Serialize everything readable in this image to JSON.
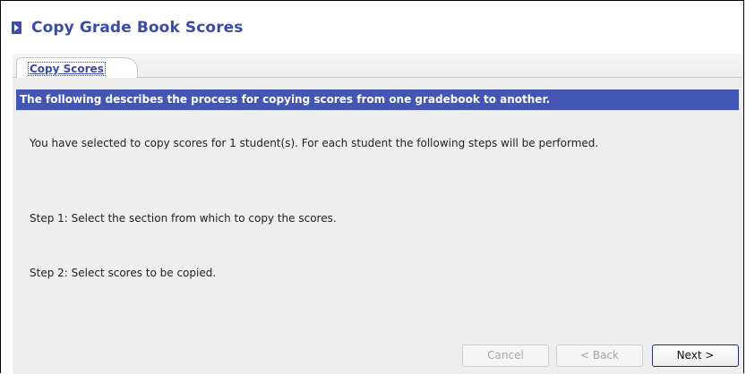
{
  "page": {
    "title": "Copy Grade Book Scores",
    "title_icon": "right-arrow-box-icon"
  },
  "tabs": [
    {
      "label": "Copy Scores",
      "selected": true
    }
  ],
  "content": {
    "header": "The following describes the process for copying scores from one gradebook to another.",
    "intro": "You have selected to copy scores for 1 student(s). For each student the following steps will be performed.",
    "step1": "Step 1: Select the section from which to copy the scores.",
    "step2": "Step 2: Select scores to be copied."
  },
  "buttons": {
    "cancel": {
      "label": "Cancel",
      "enabled": false
    },
    "back": {
      "label": "< Back",
      "enabled": false
    },
    "next": {
      "label": "Next >",
      "enabled": true
    }
  },
  "colors": {
    "title": "#3a4ba5",
    "header_bar": "#4356b3",
    "panel_bg": "#eeeeee"
  }
}
